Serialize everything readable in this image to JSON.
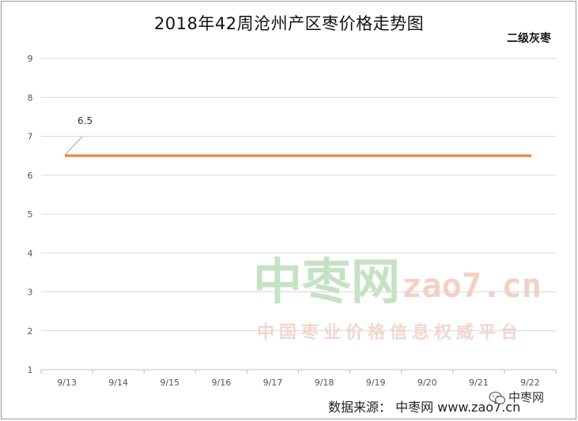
{
  "chart_data": {
    "type": "line",
    "title": "2018年42周沧州产区枣价格走势图",
    "categories": [
      "9/13",
      "9/14",
      "9/15",
      "9/16",
      "9/17",
      "9/18",
      "9/19",
      "9/20",
      "9/21",
      "9/22"
    ],
    "series": [
      {
        "name": "二级灰枣",
        "values": [
          6.5,
          6.5,
          6.5,
          6.5,
          6.5,
          6.5,
          6.5,
          6.5,
          6.5,
          6.5
        ]
      }
    ],
    "data_labels": [
      {
        "index": 0,
        "text": "6.5"
      }
    ],
    "ylim": [
      1,
      9
    ],
    "yticks": [
      "1",
      "2",
      "3",
      "4",
      "5",
      "6",
      "7",
      "8",
      "9"
    ],
    "grid": true,
    "legend": "top-right",
    "colors": {
      "series": "#f08a4b",
      "grid": "#d9d9d9",
      "axis": "#bfbfbf"
    }
  },
  "watermark": {
    "cn": "中枣网",
    "en": "zao7.cn",
    "slogan": "中国枣业价格信息权威平台"
  },
  "footer": {
    "source": "数据来源：  中枣网 www.zao7.cn",
    "brand": "中枣网",
    "brand_icon": "wechat-icon"
  }
}
